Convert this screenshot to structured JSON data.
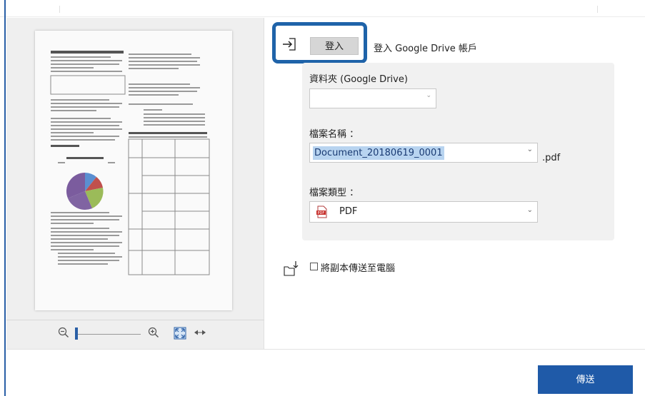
{
  "login": {
    "button_label": "登入",
    "text": "登入 Google Drive 帳戶"
  },
  "folder": {
    "label": "資料夾 (Google Drive)",
    "value": ""
  },
  "file_name": {
    "label": "檔案名稱 ：",
    "value": "Document_20180619_0001",
    "extension": ".pdf"
  },
  "file_type": {
    "label": "檔案類型 ：",
    "value": "PDF"
  },
  "copy_option": {
    "label": "將副本傳送至電腦",
    "checked": false
  },
  "send_button": "傳送",
  "preview": {
    "zoom_out_icon": "zoom-out-icon",
    "zoom_in_icon": "zoom-in-icon",
    "fit_page_icon": "fit-page-icon",
    "fit_width_icon": "fit-width-icon"
  },
  "colors": {
    "accent": "#1f5aa8",
    "highlight_border": "#1f63a9",
    "panel_bg": "#f1f1f1"
  }
}
